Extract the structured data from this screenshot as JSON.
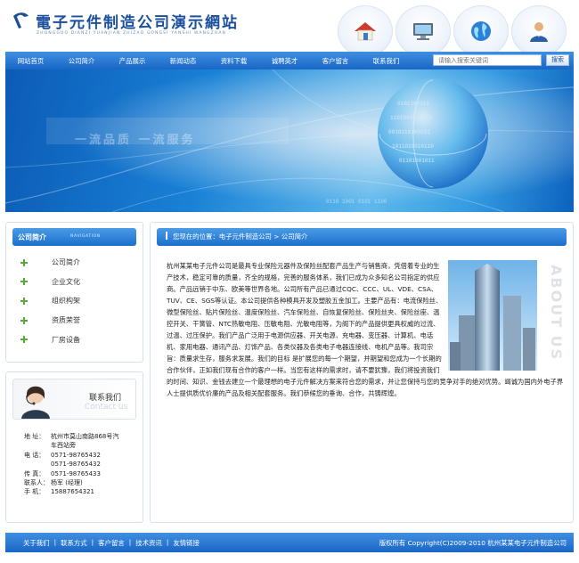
{
  "header": {
    "site_title": "電子元件制造公司演示網站",
    "site_pinyin": "ZHONGGUO DIANZI YUANJIAN ZHIZAO GONGSI YANSHI WANGZHAN",
    "icons": [
      "home-icon",
      "computer-icon",
      "globe-icon",
      "user-icon"
    ]
  },
  "nav": {
    "items": [
      "网站首页",
      "公司简介",
      "产品展示",
      "新闻动态",
      "资料下载",
      "诚聘英才",
      "客户留言",
      "联系我们"
    ],
    "search_placeholder": "请输入搜索关键词",
    "search_button": "搜索"
  },
  "banner": {
    "slogan": "一流品质 一流服务"
  },
  "sidebar": {
    "category_title": "公司简介",
    "category_en": "NAVIGATION",
    "items": [
      "公司简介",
      "企业文化",
      "组织构架",
      "资质荣誉",
      "厂房设备"
    ]
  },
  "contact": {
    "title": "联系我们",
    "title_en": "Contact us",
    "address_label": "地 址：",
    "address_value": "杭州市莫山南路868号汽",
    "address_value2": "车西站旁",
    "phone_label": "电 话：",
    "phone1": "0571-98765432",
    "phone2": "0571-98765432",
    "fax_label": "传 真：",
    "fax": "0571-98765433",
    "person_label": "联系人：",
    "person": "杨军 (经理)",
    "mobile_label": "手 机：",
    "mobile": "15887654321"
  },
  "main": {
    "breadcrumb_prefix": "您现在的位置：",
    "breadcrumb_home": "电子元件制造公司",
    "breadcrumb_sep": " > ",
    "breadcrumb_current": "公司简介",
    "about_en": "ABOUT US",
    "body": "杭州某某电子元件公司是最具专业保险元器件及保险丝配套产品生产与销售商，凭借着专业的生产技术，稳定可靠的质量，齐全的规格，完善的服务体系，我们已成为众多知名公司指定的供应商。产品远销于中东、欧美等世界各地。公司所有产品已通过CQC、CCC、UL、VDE、CSA、TUV、CE、SGS等认证。本公司提供各种模具开发及塑胶五金加工。主要产品有：电流保险丝、微型保险丝、贴片保险丝、温度保险丝、汽车保险丝、自恢复保险丝、保险丝夹、保险丝座、温控开关、干簧管、NTC热敏电阻、压敏电阻、光敏电阻等，为阁下的产品提供更具权威的过流、过温、过压保护。我们产品广泛用于电源供应器、开关电源、充电器、变压器、计算机、电话机、家用电器、通讯产品、灯饰产品、各类仪器及各类电子电器连接线、电机产品等。我司宗旨：质量求生存，服务求发展。我们的目标 是扩展您的每一个期望，并期望和您成为一个长期的合作伙伴，正如我们现有合作的客户一样。当您有这样的需求时，请不要犹豫，我们将投资我们的时间、知识、金钱去建立一个最理想的电子元件解决方案来符合您的需求，并让您保持与您的竞争对手的绝对优势。竭诚为国内外电子界人士提供质优价廉的产品及相关配套服务。我们恭候您的垂询、合作，共铸辉煌。"
  },
  "footer": {
    "links": [
      "关于我们",
      "联系方式",
      "客户留言",
      "技术资讯",
      "友情链接"
    ],
    "separator": "|",
    "copyright": "版权所有 Copyright(C)2009-2010 杭州某某电子元件制造公司"
  },
  "colors": {
    "primary_blue": "#1a66c6",
    "nav_top": "#3f8fe0",
    "plus_green": "#5aa83a",
    "logo_blue": "#1a4f9c"
  }
}
